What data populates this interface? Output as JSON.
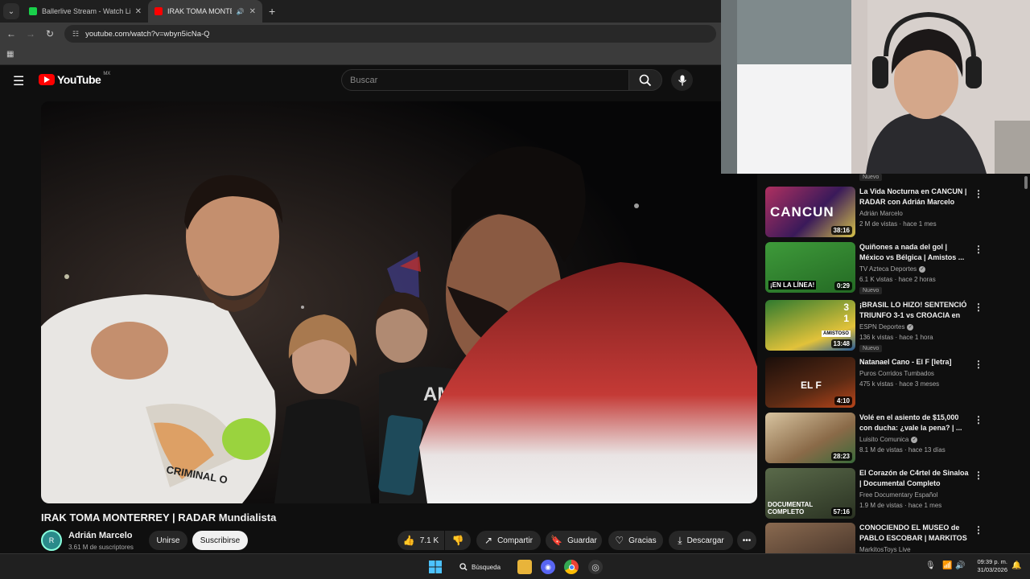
{
  "browser": {
    "tabs": [
      {
        "title": "Ballerlive Stream - Watch Live",
        "favicon_color": "#19d14b",
        "active": false
      },
      {
        "title": "IRAK TOMA MONTERREY | I",
        "favicon_color": "#ff0000",
        "active": true
      }
    ],
    "url": "youtube.com/watch?v=wbyn5icNa-Q"
  },
  "youtube": {
    "logo": "YouTube",
    "region": "MX",
    "search_placeholder": "Buscar",
    "video": {
      "title": "IRAK TOMA MONTERREY | RADAR Mundialista",
      "channel": "Adrián Marcelo",
      "subscribers": "3.61 M de suscriptores",
      "likes": "7.1 K",
      "buttons": {
        "join": "Unirse",
        "subscribe": "Suscribirse",
        "share": "Compartir",
        "save": "Guardar",
        "thanks": "Gracias",
        "download": "Descargar"
      }
    },
    "recommendations": [
      {
        "title": "La Vida Nocturna en CANCUN | RADAR con Adrián Marcelo",
        "channel": "Adrián Marcelo",
        "meta": "2 M de vistas · hace 1 mes",
        "duration": "38:16",
        "verified": false,
        "badge": "",
        "thumb_color": "#5a1f6e"
      },
      {
        "title": "Quiñones a nada del gol | México vs Bélgica | Amistos ...",
        "channel": "TV Azteca Deportes",
        "meta": "6.1 K vistas · hace 2 horas",
        "duration": "0:29",
        "verified": true,
        "badge": "Nuevo",
        "thumb_color": "#2f7d2f"
      },
      {
        "title": "¡BRASIL LO HIZO! SENTENCIÓ TRIUNFO 3-1 vs CROACIA en a...",
        "channel": "ESPN Deportes",
        "meta": "136 k vistas · hace 1 hora",
        "duration": "13:48",
        "verified": true,
        "badge": "Nuevo",
        "thumb_color": "#3a7a3a"
      },
      {
        "title": "Natanael Cano - El F [letra]",
        "channel": "Puros Corridos Tumbados",
        "meta": "475 k vistas · hace 3 meses",
        "duration": "4:10",
        "verified": false,
        "badge": "",
        "thumb_color": "#2a1510"
      },
      {
        "title": "Volé en el asiento de $15,000 con ducha: ¿vale la pena? | ...",
        "channel": "Luisito Comunica",
        "meta": "8.1 M de vistas · hace 13 días",
        "duration": "28:23",
        "verified": true,
        "badge": "",
        "thumb_color": "#a8845e"
      },
      {
        "title": "El Corazón de C4rtel de Sinaloa | Documental Completo",
        "channel": "Free Documentary Español",
        "meta": "1.9 M de vistas · hace 1 mes",
        "duration": "57:16",
        "verified": false,
        "badge": "",
        "thumb_color": "#4d5a3a"
      },
      {
        "title": "CONOCIENDO EL MUSEO de PABLO ESCOBAR | MARKITOS ...",
        "channel": "MarkitosToys Live",
        "meta": "",
        "duration": "",
        "verified": false,
        "badge": "",
        "thumb_color": "#6a4a3a"
      }
    ],
    "partial_badge": "Nuevo"
  },
  "thumb_overlays": {
    "cancun": "CANCUN",
    "linea": "¡EN LA LÍNEA!",
    "score_top": "3",
    "score_bottom": "1",
    "amistoso": "AMISTOSO",
    "elf": "EL F",
    "doc": "DOCUMENTAL COMPLETO"
  },
  "video_overlay_text": {
    "shirt": "CRIMINAL O",
    "shirt2": "AMON"
  },
  "taskbar": {
    "search_label": "Búsqueda",
    "time": "09:39 p. m.",
    "date": "31/03/2026"
  }
}
